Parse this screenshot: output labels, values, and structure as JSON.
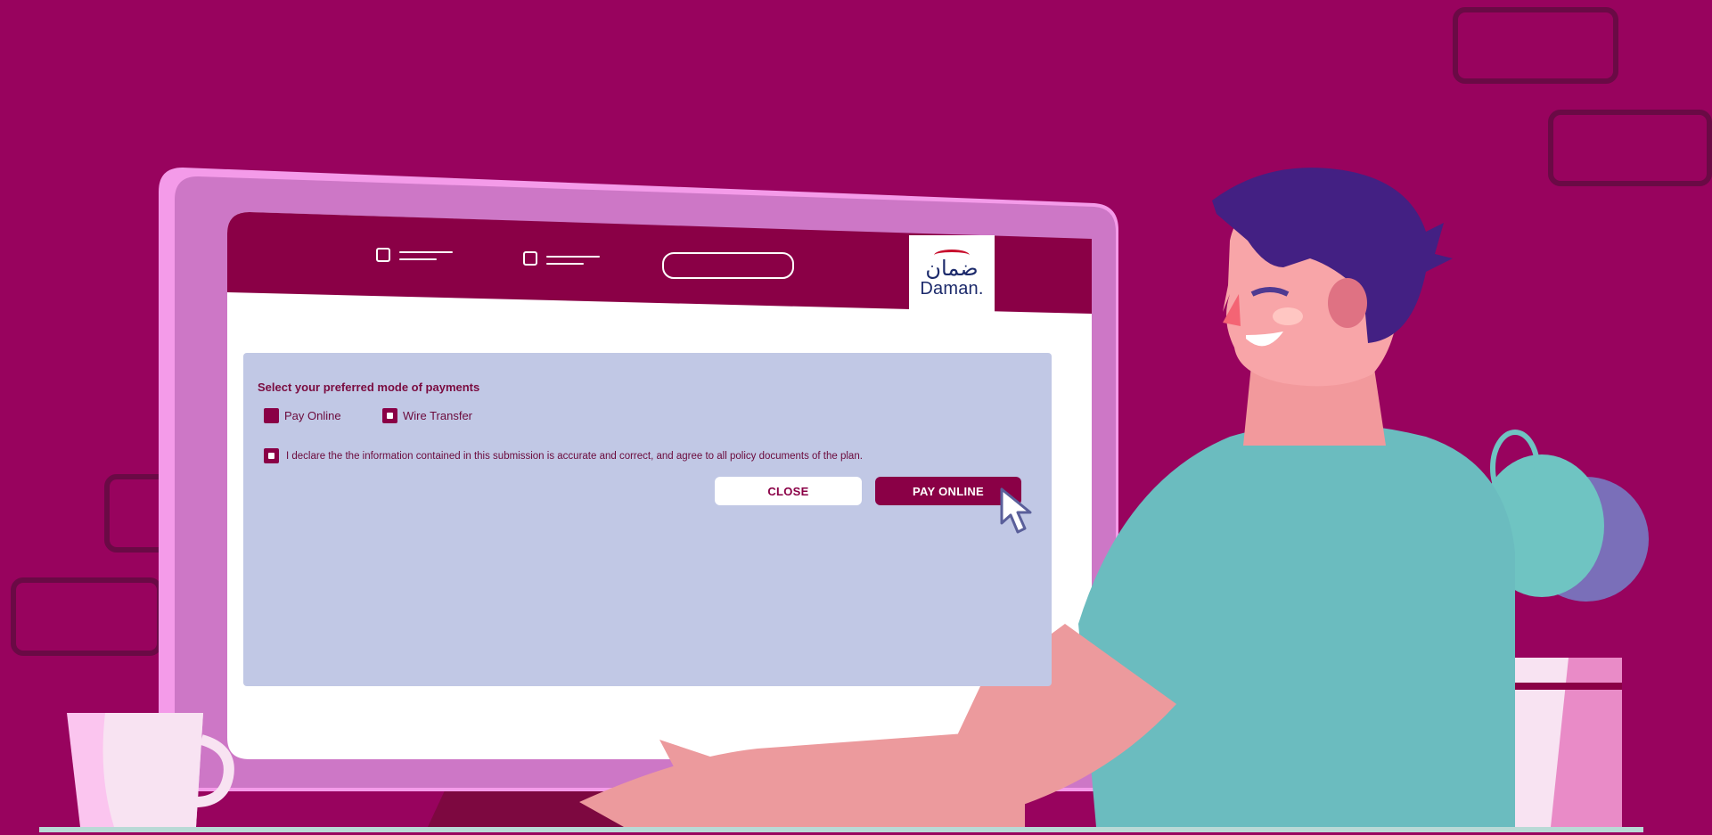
{
  "colors": {
    "background": "#98035e",
    "brand": "#8a0046",
    "panel": "#c1c8e5",
    "monitor": "#cf79c6"
  },
  "header": {
    "nav_icons": [
      "checkbox-icon",
      "checkbox-icon",
      "search-pill"
    ]
  },
  "logo": {
    "arabic": "ضمان",
    "english": "Daman."
  },
  "form": {
    "title": "Select your preferred mode of payments",
    "options": [
      {
        "label": "Pay Online",
        "checked": true
      },
      {
        "label": "Wire Transfer",
        "checked": false
      }
    ],
    "declaration": "I declare the the information contained in this submission is accurate and correct, and agree to all policy documents of the plan.",
    "close_label": "CLOSE",
    "pay_label": "PAY ONLINE"
  }
}
